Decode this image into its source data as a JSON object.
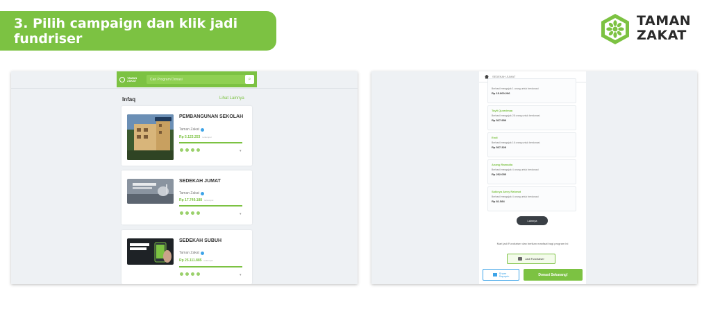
{
  "banner": {
    "text": "3. Pilih campaign dan klik jadi fundriser"
  },
  "brand": {
    "line1": "TAMAN",
    "line2": "ZAKAT",
    "color": "#7cc242"
  },
  "left_screen": {
    "header": {
      "logo_text": "TAMAN ZAKAT",
      "search_placeholder": "Cari Program Donasi"
    },
    "section_title": "Infaq",
    "see_all": "Lihat Lainnya",
    "cards": [
      {
        "title": "PEMBANGUNAN SEKOLAH",
        "org": "Taman Zakat",
        "amount": "Rp 5.123.253",
        "amount_note": "terkumpul"
      },
      {
        "title": "SEDEKAH JUMAT",
        "org": "Taman Zakat",
        "amount": "Rp 17.749.188",
        "amount_note": "terkumpul"
      },
      {
        "title": "SEDEKAH SUBUH",
        "org": "Taman Zakat",
        "amount": "Rp 25.111.885",
        "amount_note": "terkumpul"
      }
    ]
  },
  "right_screen": {
    "header": "SEDEKAH JUMAT",
    "donors": [
      {
        "name": "",
        "sub": "Berhasil mengajak 1 orang untuk berdonasi",
        "amount": "Rp 15.000.206"
      },
      {
        "name": "Tayfi Qurarimaa",
        "sub": "Berhasil mengajak 28 orang untuk berdonasi",
        "amount": "Rp 527.959"
      },
      {
        "name": "Endi",
        "sub": "Berhasil mengajak 16 orang untuk berdonasi",
        "amount": "Rp 537.328"
      },
      {
        "name": "Anang Ramadia",
        "sub": "Berhasil mengajak 4 orang untuk berdonasi",
        "amount": "Rp 252.055"
      },
      {
        "name": "Sakinya Amry Rahmat",
        "sub": "Berhasil mengajak 4 orang untuk berdonasi",
        "amount": "Rp 81.584"
      }
    ],
    "more_button": "Lainnya",
    "invite_text": "Mari jadi Fundraiser dan berikan manfaat bagi program ini",
    "fundraiser_button": "Jadi Fundraiser",
    "share_button": {
      "line1": "Share",
      "line2": "Sapupin"
    },
    "donate_button": "Donasi Sekarang!"
  }
}
